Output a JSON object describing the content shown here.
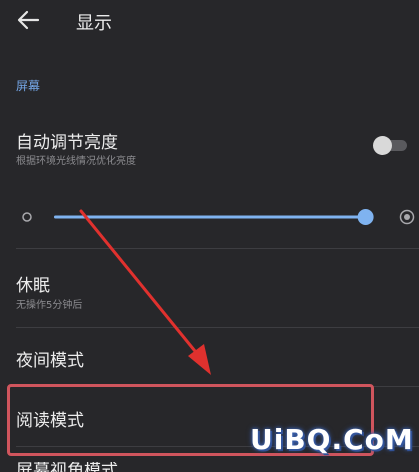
{
  "header": {
    "title": "显示"
  },
  "screen_section": {
    "title": "屏幕"
  },
  "auto_brightness": {
    "title": "自动调节亮度",
    "subtitle": "根据环境光线情况优化亮度",
    "enabled": false
  },
  "brightness": {
    "level": 0.98
  },
  "sleep": {
    "title": "休眠",
    "subtitle": "无操作5分钟后"
  },
  "night_mode": {
    "title": "夜间模式"
  },
  "reading_mode": {
    "title": "阅读模式"
  },
  "next_item": {
    "title": "屏幕视角模式"
  },
  "watermark": {
    "text": "UiBQ.CoM"
  },
  "colors": {
    "accent": "#74a6e6",
    "slider_thumb": "#7fb3f0",
    "annotation": "#e0312e"
  }
}
